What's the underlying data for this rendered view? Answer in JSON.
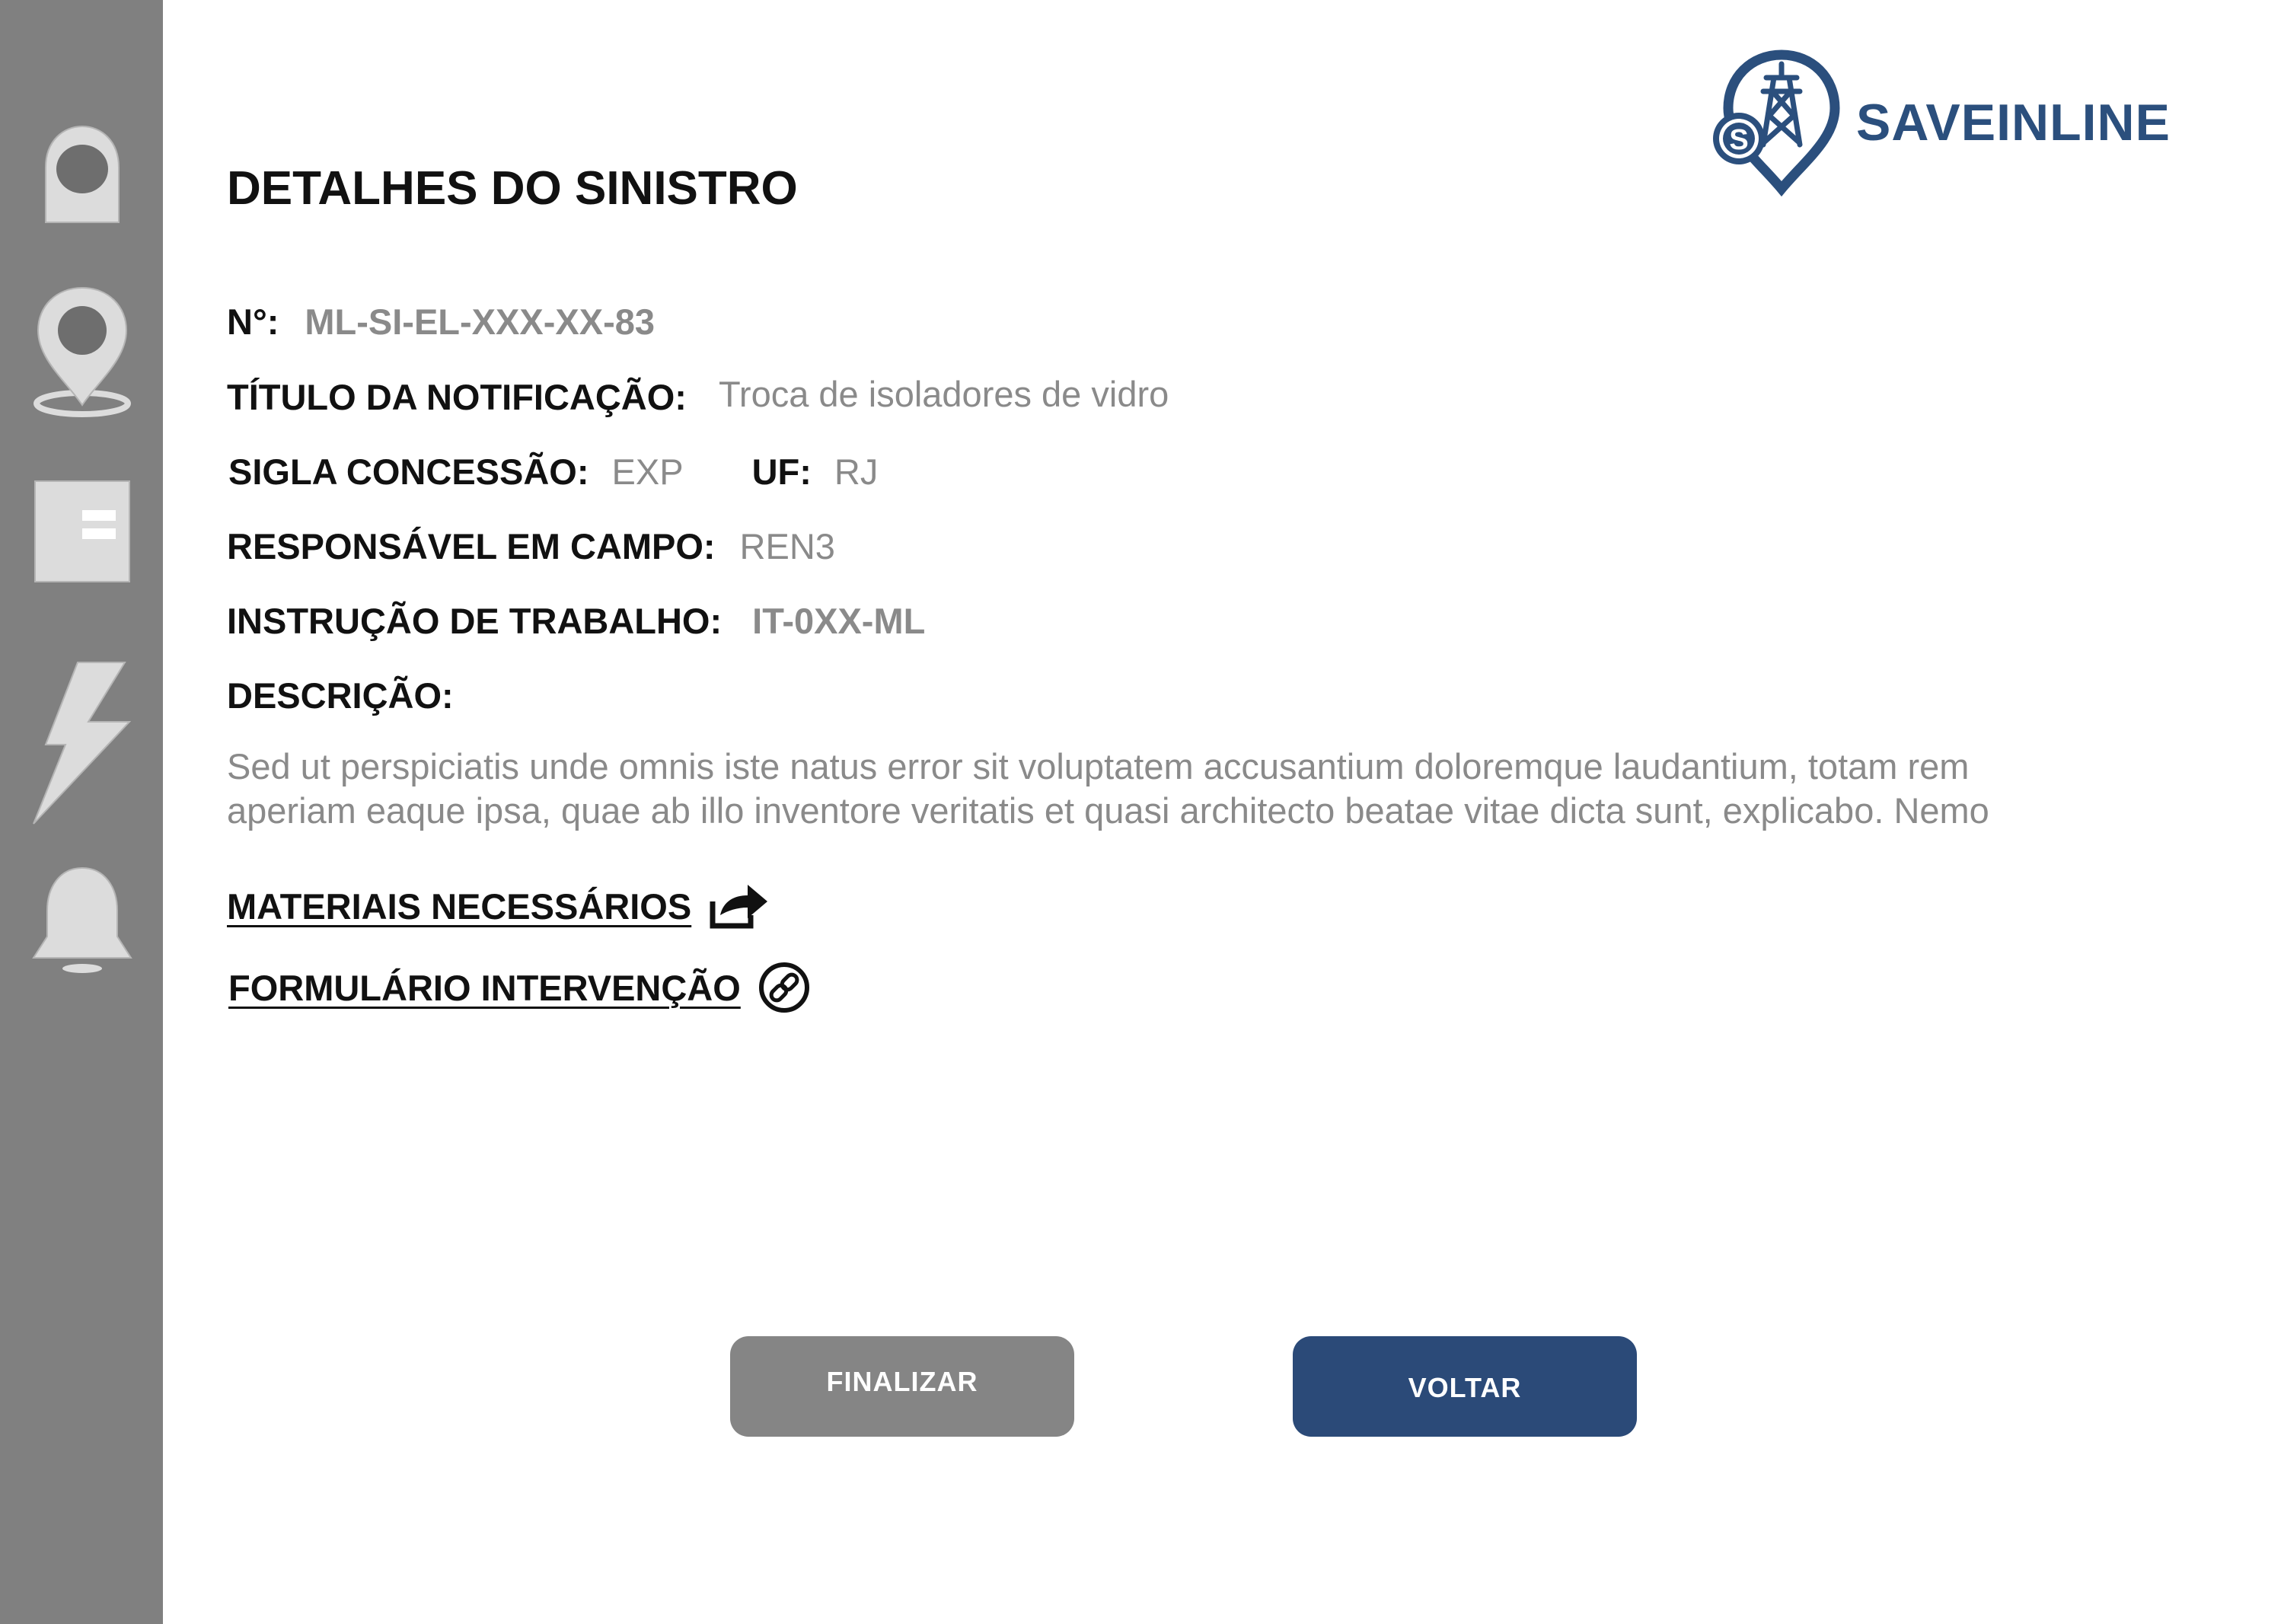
{
  "brand": {
    "name": "SAVEINLINE",
    "badge_letter": "S",
    "color": "#2b4f7d"
  },
  "page": {
    "title": "DETALHES DO SINISTRO"
  },
  "sidebar": {
    "items": [
      {
        "icon": "profile-icon"
      },
      {
        "icon": "location-pin-icon"
      },
      {
        "icon": "document-icon"
      },
      {
        "icon": "lightning-icon"
      },
      {
        "icon": "bell-icon"
      }
    ]
  },
  "details": {
    "numero_label": "N°:",
    "numero_value": "ML-SI-EL-XXX-XX-83",
    "titulo_label": "TÍTULO DA NOTIFICAÇÃO:",
    "titulo_value": "Troca de isoladores de vidro",
    "sigla_label": "SIGLA CONCESSÃO:",
    "sigla_value": "EXP",
    "uf_label": "UF:",
    "uf_value": "RJ",
    "responsavel_label": "RESPONSÁVEL EM CAMPO:",
    "responsavel_value": "REN3",
    "instrucao_label": "INSTRUÇÃO DE TRABALHO:",
    "instrucao_value": "IT-0XX-ML",
    "descricao_label": "DESCRIÇÃO:",
    "descricao_line1": "Sed ut perspiciatis unde omnis iste natus error sit voluptatem accusantium doloremque laudantium, totam rem",
    "descricao_line2": "aperiam eaque ipsa, quae ab illo inventore veritatis et quasi architecto beatae vitae dicta sunt, explicabo. Nemo"
  },
  "links": {
    "materiais": "MATERIAIS NECESSÁRIOS",
    "formulario": "FORMULÁRIO INTERVENÇÃO"
  },
  "buttons": {
    "finalizar": "FINALIZAR",
    "voltar": "VOLTAR",
    "finalizar_color": "#858585",
    "voltar_color": "#2b4a78"
  }
}
